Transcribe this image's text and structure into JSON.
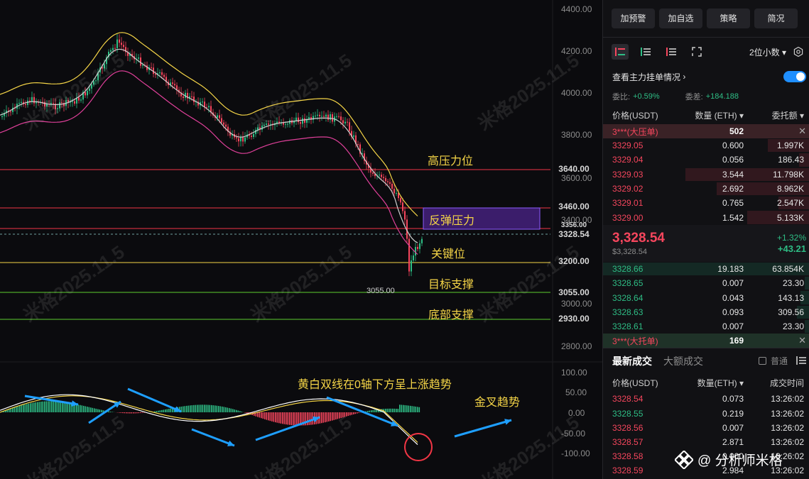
{
  "chart": {
    "price_axis": [
      "4400.00",
      "4200.00",
      "4000.00",
      "3800.00",
      "3600.00",
      "3400.00",
      "3000.00",
      "2800.00"
    ],
    "macd_axis": [
      "100.00",
      "50.00",
      "0.00",
      "-50.00",
      "-100.00"
    ],
    "price_tags": [
      {
        "value": "3640.00",
        "bg": "#f23645",
        "fg": "#ffffff"
      },
      {
        "value": "3460.00",
        "bg": "#f23645",
        "fg": "#ffffff"
      },
      {
        "value": "3356.00",
        "bg": "#f23645",
        "fg": "#ffffff"
      },
      {
        "value": "3328.54",
        "bg": "#2ebd85",
        "fg": "#ffffff"
      },
      {
        "value": "3200.00",
        "bg": "#f5d547",
        "fg": "#111111"
      },
      {
        "value": "3055.00",
        "bg": "#5ccc2f",
        "fg": "#111111"
      },
      {
        "value": "2930.00",
        "bg": "#5ccc2f",
        "fg": "#111111"
      }
    ],
    "annotations": {
      "high_resistance": "高压力位",
      "rebound_resistance": "反弹压力",
      "key_level": "关键位",
      "target_support": "目标支撑",
      "bottom_support": "底部支撑",
      "macd_note": "黄白双线在0轴下方呈上涨趋势",
      "golden_cross": "金叉趋势"
    },
    "low_marker": "3055.00",
    "watermark": "米格2025.11.5",
    "colors": {
      "up": "#2ebd85",
      "down": "#f6465d",
      "yellow": "#f5d547",
      "red_line": "#f23645",
      "green_line": "#5ccc2f",
      "arrow": "#1e9fff"
    }
  },
  "right_panel": {
    "buttons": [
      "加预警",
      "加自选",
      "策略",
      "简况"
    ],
    "decimals": "2位小数",
    "depth_link": "查看主力挂单情况",
    "ratio": {
      "label1": "委比:",
      "value1": "+0.59%",
      "label2": "委差:",
      "value2": "+184.188"
    },
    "orderbook_head": {
      "price": "价格(USDT)",
      "qty": "数量 (ETH)",
      "total": "委托额"
    },
    "big_ask": {
      "name": "3***(大压单)",
      "qty": "502"
    },
    "asks": [
      {
        "price": "3329.05",
        "qty": "0.600",
        "total": "1.997K",
        "fill": 0.2
      },
      {
        "price": "3329.04",
        "qty": "0.056",
        "total": "186.43",
        "fill": 0.05
      },
      {
        "price": "3329.03",
        "qty": "3.544",
        "total": "11.798K",
        "fill": 0.6
      },
      {
        "price": "3329.02",
        "qty": "2.692",
        "total": "8.962K",
        "fill": 0.45
      },
      {
        "price": "3329.01",
        "qty": "0.765",
        "total": "2.547K",
        "fill": 0.15
      },
      {
        "price": "3329.00",
        "qty": "1.542",
        "total": "5.133K",
        "fill": 0.3
      }
    ],
    "mid": {
      "price": "3,328.54",
      "usd": "$3,328.54",
      "pct": "+1.32%",
      "change": "+43.21"
    },
    "bids": [
      {
        "price": "3328.66",
        "qty": "19.183",
        "total": "63.854K",
        "fill": 1.0
      },
      {
        "price": "3328.65",
        "qty": "0.007",
        "total": "23.30",
        "fill": 0.02
      },
      {
        "price": "3328.64",
        "qty": "0.043",
        "total": "143.13",
        "fill": 0.04
      },
      {
        "price": "3328.63",
        "qty": "0.093",
        "total": "309.56",
        "fill": 0.06
      },
      {
        "price": "3328.61",
        "qty": "0.007",
        "total": "23.30",
        "fill": 0.02
      }
    ],
    "big_bid": {
      "name": "3***(大托单)",
      "qty": "169"
    },
    "trade_tabs": {
      "latest": "最新成交",
      "large": "大额成交",
      "normal": "普通"
    },
    "trade_head": {
      "price": "价格(USDT)",
      "qty": "数量(ETH)",
      "time": "成交时间"
    },
    "trades": [
      {
        "price": "3328.54",
        "qty": "0.073",
        "time": "13:26:02",
        "side": "sell"
      },
      {
        "price": "3328.55",
        "qty": "0.219",
        "time": "13:26:02",
        "side": "buy"
      },
      {
        "price": "3328.56",
        "qty": "0.007",
        "time": "13:26:02",
        "side": "sell"
      },
      {
        "price": "3328.57",
        "qty": "2.871",
        "time": "13:26:02",
        "side": "sell"
      },
      {
        "price": "3328.58",
        "qty": "0.000",
        "time": "13:26:02",
        "side": "sell"
      },
      {
        "price": "3328.59",
        "qty": "2.984",
        "time": "13:26:02",
        "side": "sell"
      }
    ],
    "brand": "@ 分析师米格"
  }
}
